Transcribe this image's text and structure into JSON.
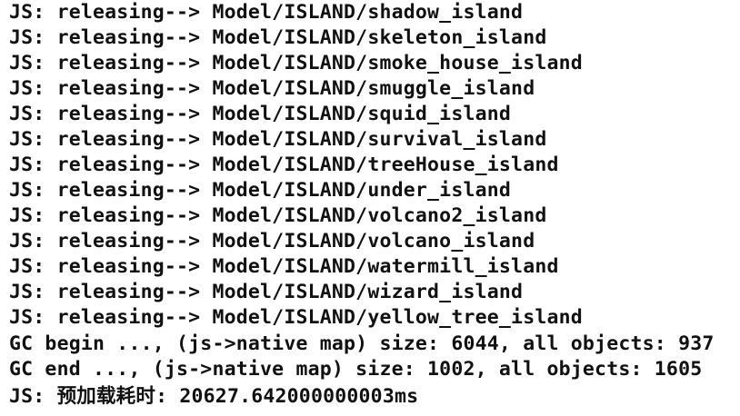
{
  "console": {
    "lines": [
      "JS: releasing--> Model/ISLAND/shadow_island",
      "JS: releasing--> Model/ISLAND/skeleton_island",
      "JS: releasing--> Model/ISLAND/smoke_house_island",
      "JS: releasing--> Model/ISLAND/smuggle_island",
      "JS: releasing--> Model/ISLAND/squid_island",
      "JS: releasing--> Model/ISLAND/survival_island",
      "JS: releasing--> Model/ISLAND/treeHouse_island",
      "JS: releasing--> Model/ISLAND/under_island",
      "JS: releasing--> Model/ISLAND/volcano2_island",
      "JS: releasing--> Model/ISLAND/volcano_island",
      "JS: releasing--> Model/ISLAND/watermill_island",
      "JS: releasing--> Model/ISLAND/wizard_island",
      "JS: releasing--> Model/ISLAND/yellow_tree_island",
      "GC begin ..., (js->native map) size: 6044, all objects: 937",
      "GC end ..., (js->native map) size: 1002, all objects: 1605",
      "JS: 预加载耗时: 20627.642000000003ms"
    ]
  }
}
